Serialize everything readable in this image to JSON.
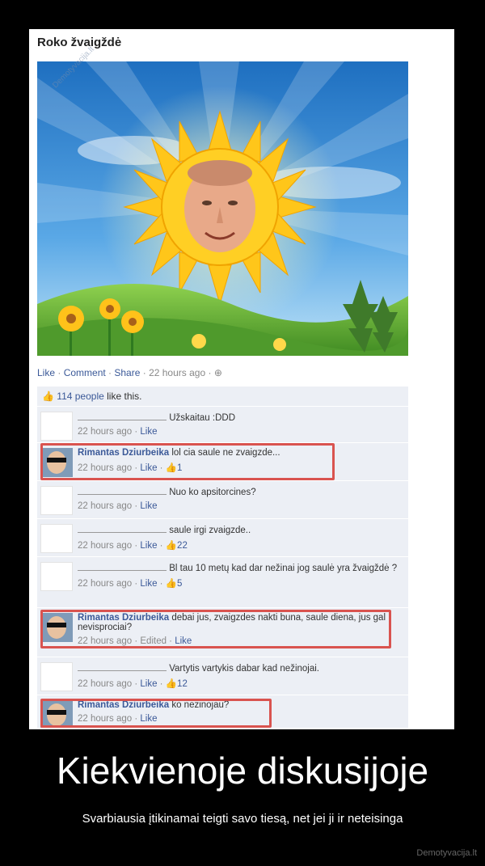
{
  "post": {
    "page_name": "Roko žvaigždė",
    "watermark": "Demotyvacija.lt",
    "actions": [
      "Like",
      "Comment",
      "Share"
    ],
    "time": "22 hours ago",
    "likes_count": "114 people",
    "likes_suffix": "like this."
  },
  "comments": [
    {
      "author": "",
      "text": "Užskaitau :DDD",
      "time": "22 hours ago",
      "like": "Like",
      "likes": ""
    },
    {
      "author": "Rimantas Dziurbeika",
      "text": "lol cia saule ne zvaigzde...",
      "time": "22 hours ago",
      "like": "Like",
      "likes": "1",
      "highlight": true
    },
    {
      "author": "",
      "text": "Nuo ko apsitorcines?",
      "time": "22 hours ago",
      "like": "Like",
      "likes": ""
    },
    {
      "author": "",
      "text": "saule irgi zvaigzde..",
      "time": "22 hours ago",
      "like": "Like",
      "likes": "22"
    },
    {
      "author": "",
      "text": "Bl tau 10 metų kad dar nežinai jog saulė yra žvaigždė ?",
      "time": "22 hours ago",
      "like": "Like",
      "likes": "5"
    },
    {
      "author": "Rimantas Dziurbeika",
      "text": "debai jus, zvaigzdes nakti buna, saule diena, jus gal nevisprociai?",
      "time": "22 hours ago",
      "like": "Like",
      "likes": "",
      "edited": "Edited",
      "highlight": true
    },
    {
      "author": "",
      "text": "Vartytis vartykis dabar kad nežinojai.",
      "time": "22 hours ago",
      "like": "Like",
      "likes": "12"
    },
    {
      "author": "Rimantas Dziurbeika",
      "text": "ko nezinojau?",
      "time": "22 hours ago",
      "like": "Like",
      "likes": "",
      "highlight": true
    }
  ],
  "caption": {
    "title": "Kiekvienoje diskusijoje",
    "subtitle": "Svarbiausia įtikinamai teigti savo tiesą, net jei ji ir neteisinga",
    "site": "Demotyvacija.lt"
  },
  "colors": {
    "link": "#3b5998",
    "highlight": "#d9534f",
    "sky": "#3a8fd6",
    "sun": "#ffcc1a",
    "grass": "#6cb33a"
  }
}
